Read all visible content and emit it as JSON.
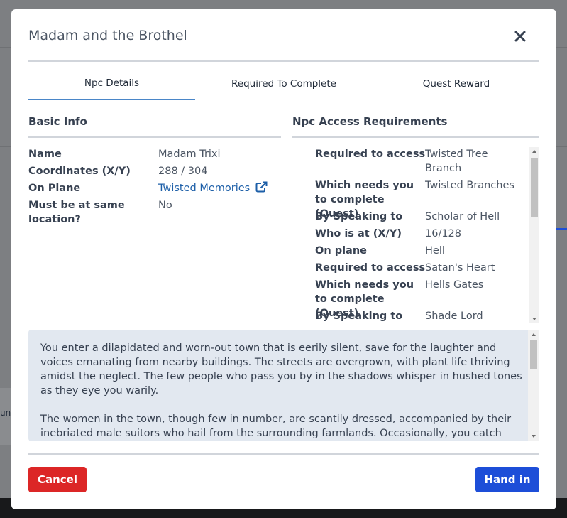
{
  "modal": {
    "title": "Madam and the Brothel"
  },
  "tabs": [
    {
      "label": "Npc Details",
      "active": true
    },
    {
      "label": "Required To Complete",
      "active": false
    },
    {
      "label": "Quest Reward",
      "active": false
    }
  ],
  "basic_info": {
    "heading": "Basic Info",
    "rows": [
      {
        "label": "Name",
        "value": "Madam Trixi"
      },
      {
        "label": "Coordinates (X/Y)",
        "value": "288 / 304"
      },
      {
        "label": "On Plane",
        "value": "Twisted Memories"
      },
      {
        "label": "Must be at same location?",
        "value": "No"
      }
    ]
  },
  "access": {
    "heading": "Npc Access Requirements",
    "rows": [
      {
        "label": "Required to access",
        "value": "Twisted Tree Branch"
      },
      {
        "label": "Which needs you to complete (Quest)",
        "value": "Twisted Branches"
      },
      {
        "label": "By Speaking to",
        "value": "Scholar of Hell"
      },
      {
        "label": "Who is at (X/Y)",
        "value": "16/128"
      },
      {
        "label": "On plane",
        "value": "Hell"
      },
      {
        "label": "Required to access",
        "value": "Satan's Heart"
      },
      {
        "label": "Which needs you to complete (Quest)",
        "value": "Hells Gates"
      },
      {
        "label": "By Speaking to",
        "value": "Shade Lord"
      }
    ]
  },
  "description": {
    "paragraphs": [
      "You enter a dilapidated and worn-out town that is eerily silent, save for the laughter and voices emanating from nearby buildings. The streets are overgrown, with plant life thriving amidst the neglect. The few people who pass you by in the shadows whisper in hushed tones as they eye you warily.",
      "The women in the town, though few in number, are scantily dressed, accompanied by their inebriated male suitors who hail from the surrounding farmlands. Occasionally, you catch"
    ]
  },
  "footer": {
    "cancel_label": "Cancel",
    "hand_in_label": "Hand in"
  },
  "background": {
    "partial_text": "und"
  },
  "colors": {
    "tab_active_underline": "#4a86c8",
    "link": "#1d5fa8",
    "cancel": "#dc2626",
    "primary": "#1d4ed8",
    "description_bg": "#e2e8f0"
  }
}
